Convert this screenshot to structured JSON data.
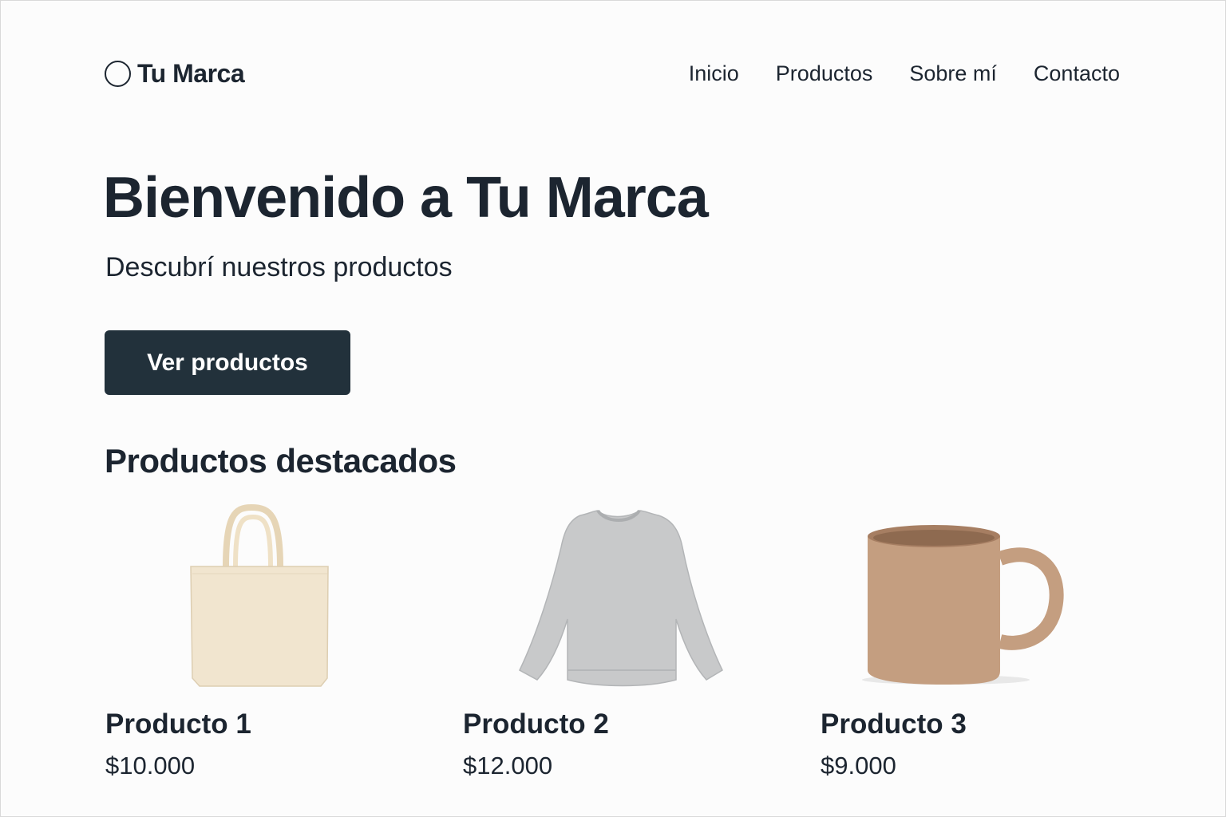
{
  "brand": {
    "name": "Tu Marca",
    "logo_icon": "circle-logo-icon"
  },
  "nav": {
    "items": [
      "Inicio",
      "Productos",
      "Sobre mí",
      "Contacto"
    ]
  },
  "hero": {
    "title": "Bienvenido a Tu Marca",
    "subtitle": "Descubrí nuestros productos",
    "cta_label": "Ver productos"
  },
  "featured": {
    "title": "Productos destacados",
    "products": [
      {
        "name": "Producto 1",
        "price": "$10.000",
        "image": "tote-bag",
        "color": "#f1e5cf"
      },
      {
        "name": "Producto 2",
        "price": "$12.000",
        "image": "sweatshirt",
        "color": "#c8c9ca"
      },
      {
        "name": "Producto 3",
        "price": "$9.000",
        "image": "mug",
        "color": "#c49e80"
      }
    ]
  },
  "colors": {
    "text": "#1c2530",
    "button": "#22313b",
    "background": "#fcfcfc"
  }
}
